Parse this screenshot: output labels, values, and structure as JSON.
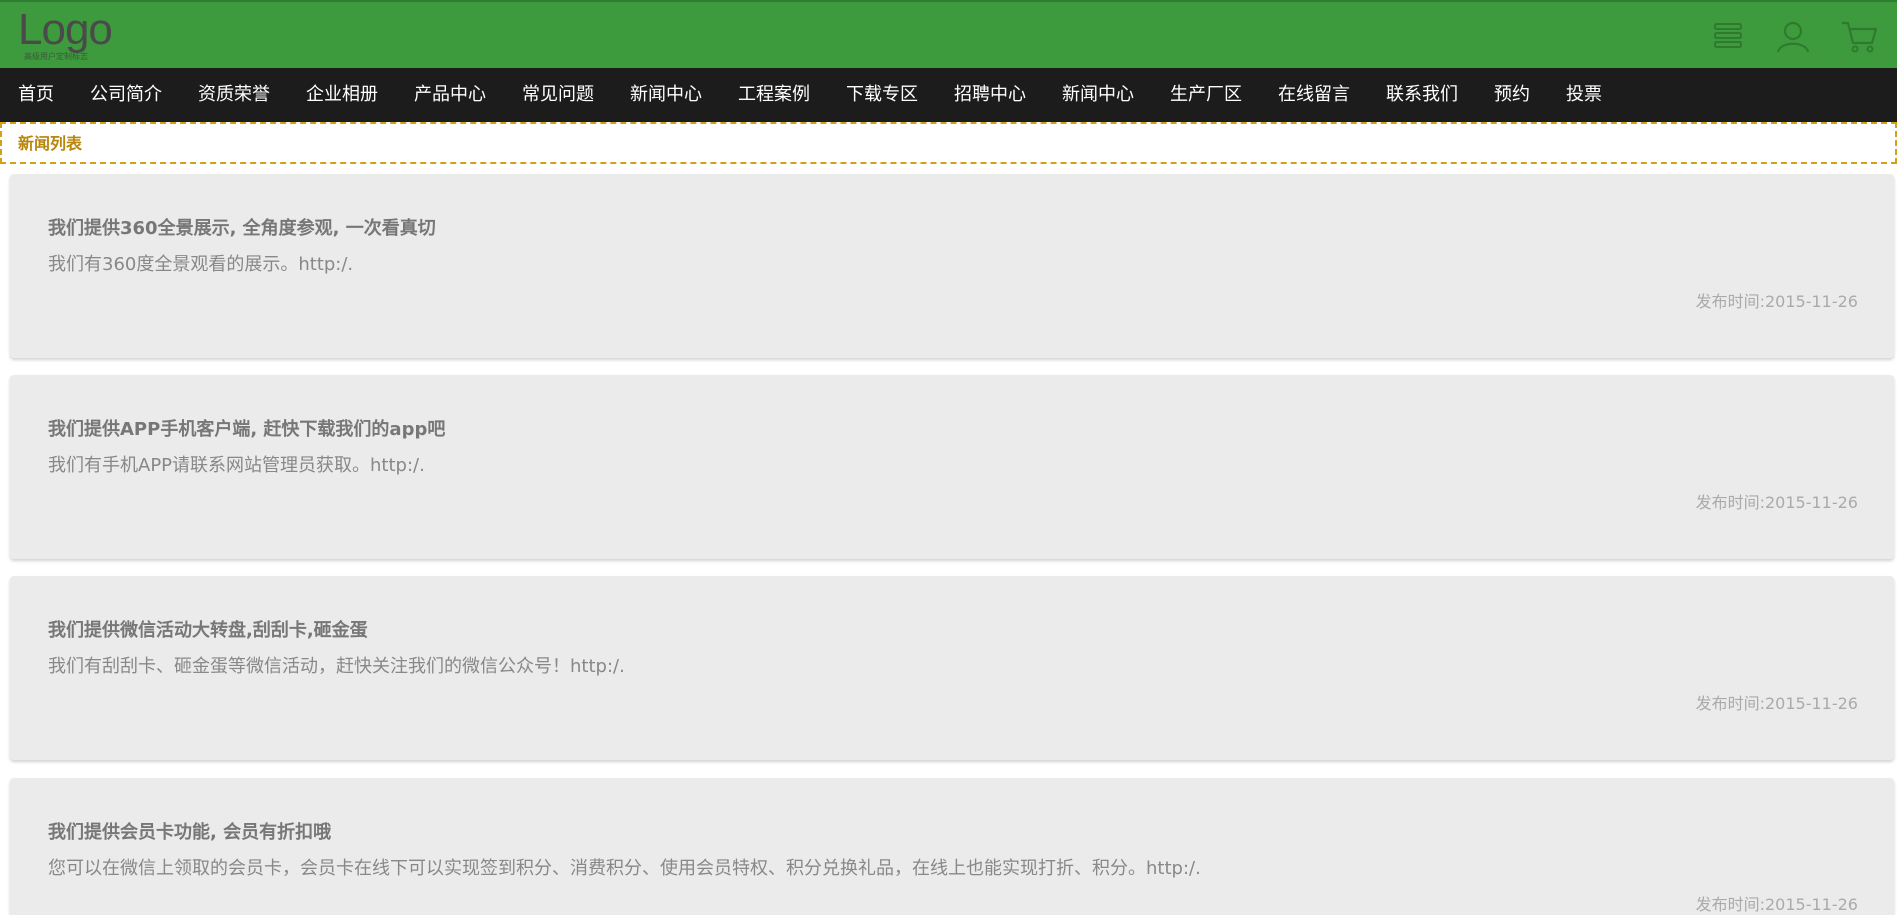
{
  "header": {
    "logo_text": "Logo",
    "logo_subtext": "高级用户定制标志",
    "bg_color": "#3d9a3d",
    "icons": [
      "menu-list-icon",
      "user-icon",
      "cart-icon"
    ]
  },
  "nav": {
    "items": [
      {
        "label": "首页"
      },
      {
        "label": "公司简介"
      },
      {
        "label": "资质荣誉"
      },
      {
        "label": "企业相册"
      },
      {
        "label": "产品中心"
      },
      {
        "label": "常见问题"
      },
      {
        "label": "新闻中心"
      },
      {
        "label": "工程案例"
      },
      {
        "label": "下载专区"
      },
      {
        "label": "招聘中心"
      },
      {
        "label": "新闻中心"
      },
      {
        "label": "生产厂区"
      },
      {
        "label": "在线留言"
      },
      {
        "label": "联系我们"
      },
      {
        "label": "预约"
      },
      {
        "label": "投票"
      }
    ]
  },
  "breadcrumb": {
    "label": "新闻列表"
  },
  "news": [
    {
      "title": "我们提供360全景展示, 全角度参观, 一次看真切",
      "summary": "我们有360度全景观看的展示。http:/.",
      "date": "发布时间:2015-11-26"
    },
    {
      "title": "我们提供APP手机客户端, 赶快下载我们的app吧",
      "summary": "我们有手机APP请联系网站管理员获取。http:/.",
      "date": "发布时间:2015-11-26"
    },
    {
      "title": "我们提供微信活动大转盘,刮刮卡,砸金蛋",
      "summary": "我们有刮刮卡、砸金蛋等微信活动，赶快关注我们的微信公众号！http:/.",
      "date": "发布时间:2015-11-26"
    },
    {
      "title": "我们提供会员卡功能, 会员有折扣哦",
      "summary": "您可以在微信上领取的会员卡，会员卡在线下可以实现签到积分、消费积分、使用会员特权、积分兑换礼品，在线上也能实现打折、积分。http:/.",
      "date": "发布时间:2015-11-26"
    }
  ]
}
